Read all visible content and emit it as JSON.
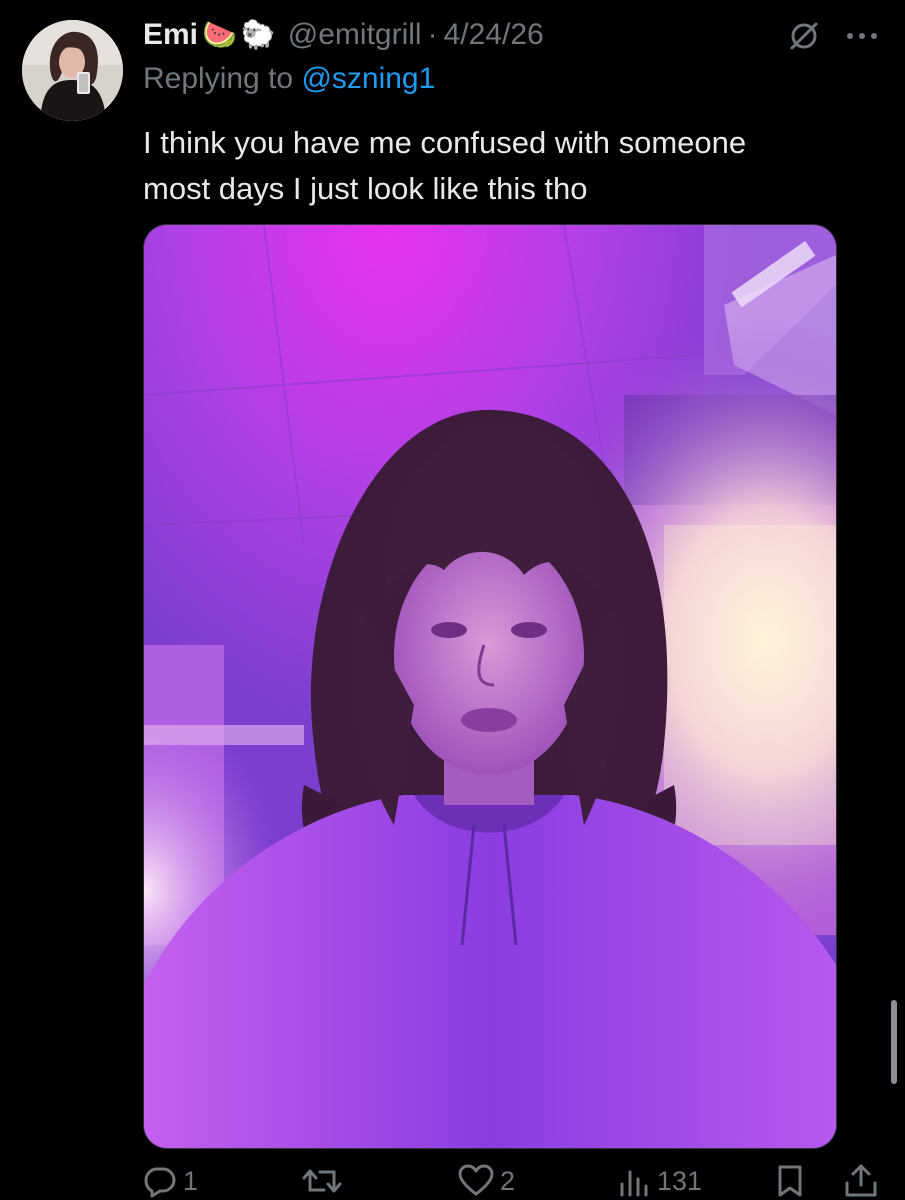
{
  "tweet": {
    "display_name": "Emi",
    "name_emojis": [
      "🍉",
      "🐑"
    ],
    "handle": "@emitgrill",
    "separator": "·",
    "date": "4/24/26",
    "replying_prefix": "Replying to",
    "replying_to": "@szning1",
    "text_lines": [
      "I think you have me confused with someone",
      "most days I just look like this tho"
    ]
  },
  "actions": {
    "replies": "1",
    "reposts": "",
    "likes": "2",
    "views": "131"
  },
  "icons": {
    "reply": "reply-icon",
    "repost": "repost-icon",
    "like": "heart-icon",
    "views": "views-icon",
    "bookmark": "bookmark-icon",
    "share": "share-icon",
    "more": "more-icon",
    "hidden": "hidden-reply-icon"
  },
  "colors": {
    "background": "#000000",
    "text": "#e7e9ea",
    "muted": "#71767b",
    "link": "#1d9bf0"
  }
}
